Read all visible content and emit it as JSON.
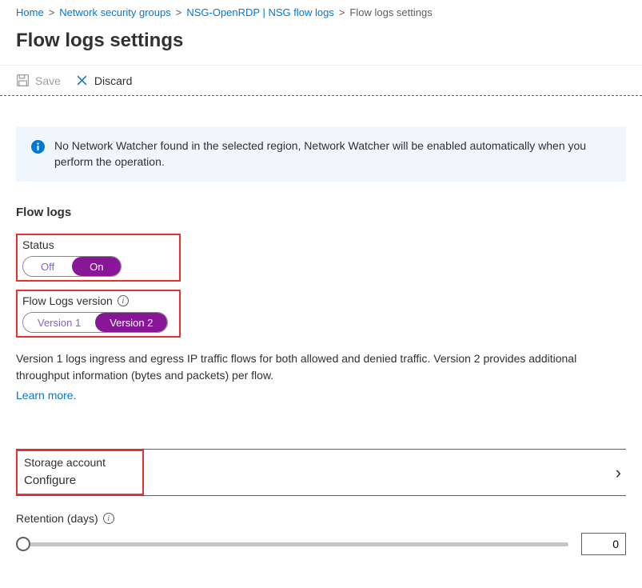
{
  "breadcrumb": {
    "items": [
      {
        "label": "Home",
        "link": true
      },
      {
        "label": "Network security groups",
        "link": true
      },
      {
        "label": "NSG-OpenRDP | NSG flow logs",
        "link": true
      },
      {
        "label": "Flow logs settings",
        "link": false
      }
    ]
  },
  "page_title": "Flow logs settings",
  "toolbar": {
    "save_label": "Save",
    "discard_label": "Discard"
  },
  "info_banner": "No Network Watcher found in the selected region, Network Watcher will be enabled automatically when you perform the operation.",
  "flow_logs": {
    "section_title": "Flow logs",
    "status": {
      "label": "Status",
      "off": "Off",
      "on": "On",
      "selected": "On"
    },
    "version": {
      "label": "Flow Logs version",
      "v1": "Version 1",
      "v2": "Version 2",
      "selected": "Version 2"
    },
    "description": "Version 1 logs ingress and egress IP traffic flows for both allowed and denied traffic. Version 2 provides additional throughput information (bytes and packets) per flow.",
    "learn_more": "Learn more."
  },
  "storage": {
    "label": "Storage account",
    "value": "Configure"
  },
  "retention": {
    "label": "Retention (days)",
    "value": "0"
  }
}
